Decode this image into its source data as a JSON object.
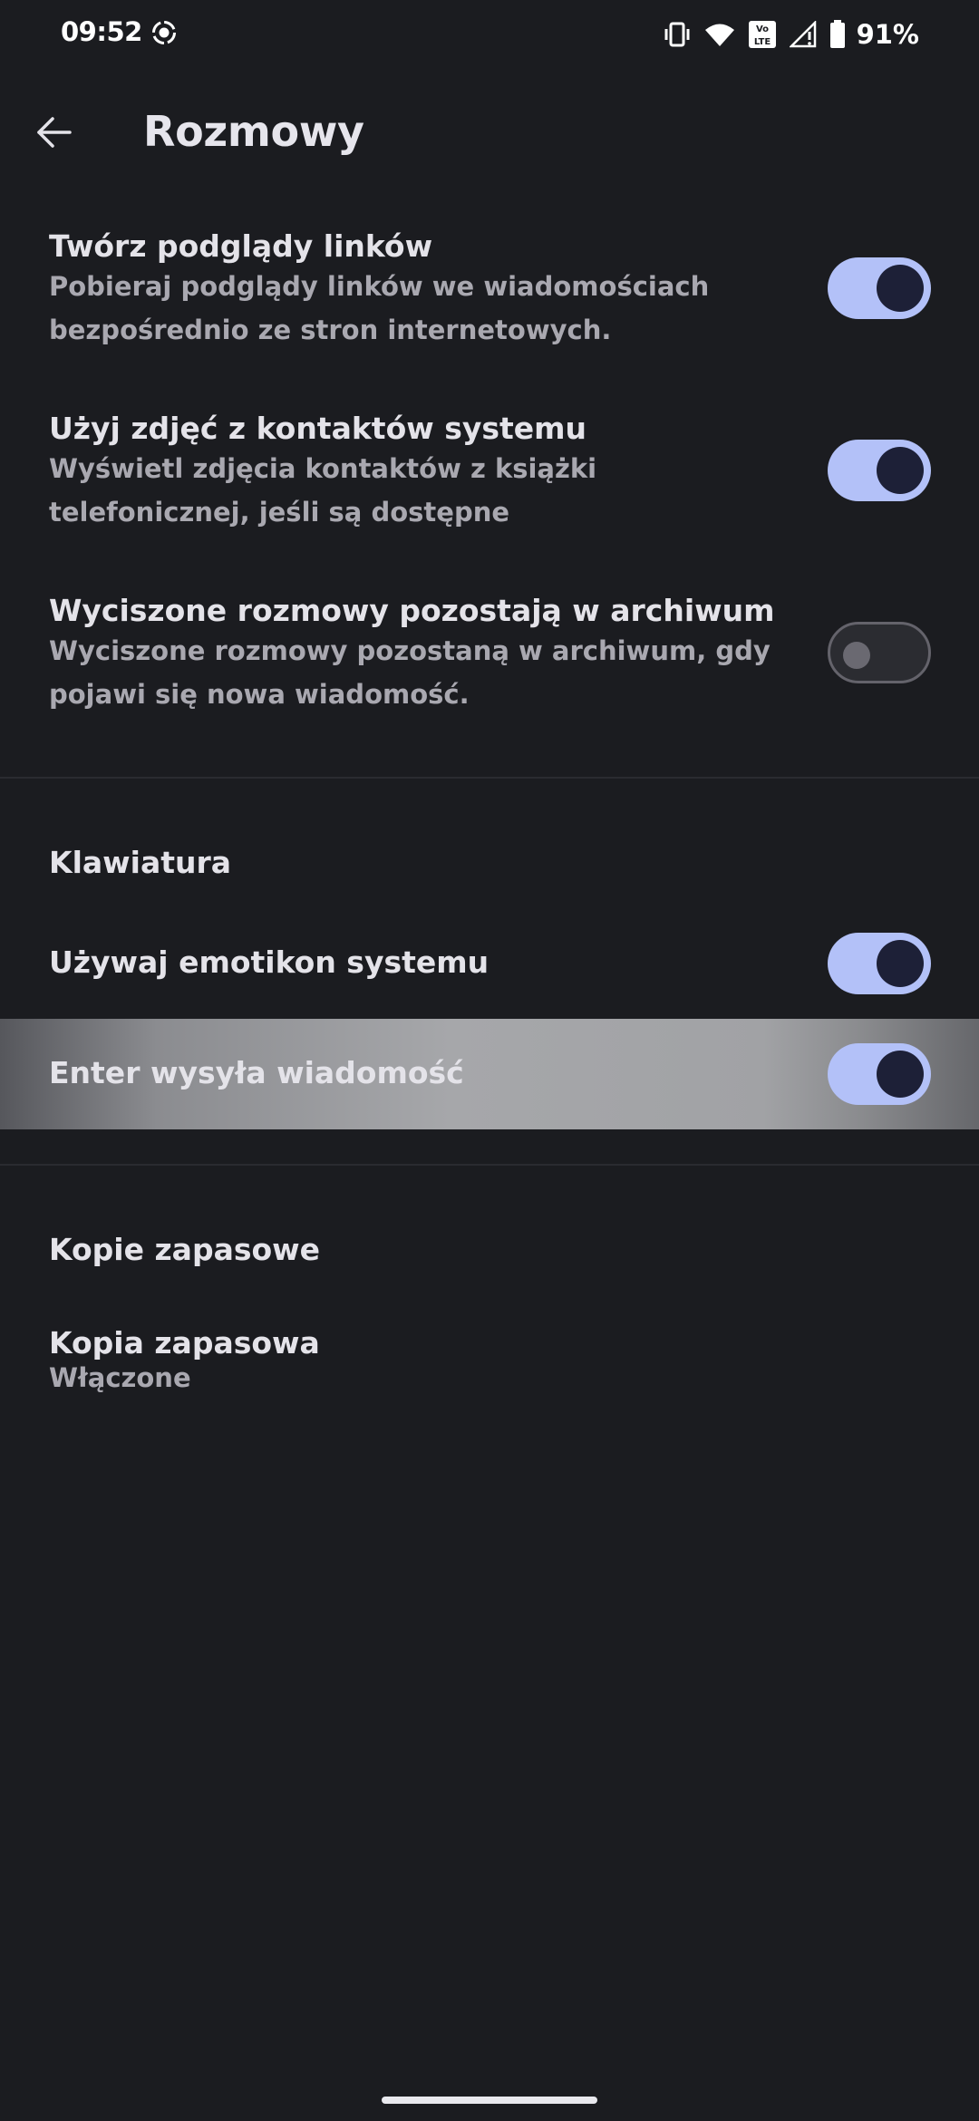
{
  "status_bar": {
    "time": "09:52",
    "battery": "91%",
    "icons": [
      "screen-record-icon",
      "vibrate-icon",
      "wifi-icon",
      "volte-icon",
      "signal-icon",
      "battery-icon"
    ]
  },
  "app_bar": {
    "title": "Rozmowy",
    "back_icon": "arrow-back-icon"
  },
  "settings": [
    {
      "title": "Twórz podglądy linków",
      "description": "Pobieraj podglądy linków we wiadomościach bezpośrednio ze stron internetowych.",
      "enabled": true
    },
    {
      "title": "Użyj zdjęć z kontaktów systemu",
      "description": "Wyświetl zdjęcia kontaktów z książki telefonicznej, jeśli są dostępne",
      "enabled": true
    },
    {
      "title": "Wyciszone rozmowy pozostają w archiwum",
      "description": "Wyciszone rozmowy pozostaną w archiwum, gdy pojawi się nowa wiadomość.",
      "enabled": false
    }
  ],
  "keyboard_section": {
    "header": "Klawiatura",
    "items": [
      {
        "title": "Używaj emotikon systemu",
        "enabled": true
      },
      {
        "title": "Enter wysyła wiadomość",
        "enabled": true
      }
    ]
  },
  "backup_section": {
    "header": "Kopie zapasowe",
    "items": [
      {
        "title": "Kopia zapasowa",
        "summary": "Włączone"
      }
    ]
  },
  "colors": {
    "background": "#1b1c20",
    "toggle_on_track": "#b3c1f8",
    "toggle_on_knob": "#1d2037",
    "toggle_off_border": "#64636b",
    "title_text": "#e4e3e9",
    "secondary_text": "#a9a8b0"
  }
}
